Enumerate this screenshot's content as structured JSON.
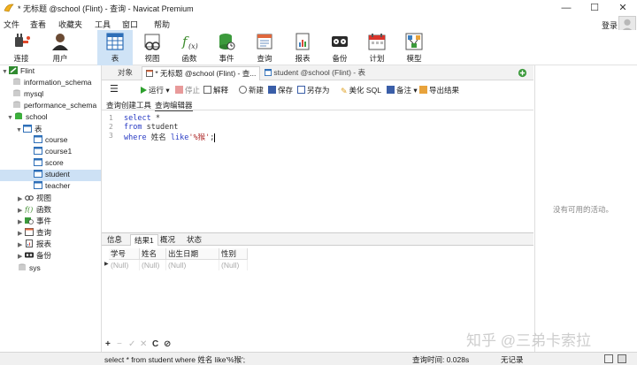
{
  "window": {
    "title": "* 无标题 @school (Flint) - 查询 - Navicat Premium",
    "minimize": "—",
    "maximize": "☐",
    "close": "✕"
  },
  "menu": [
    "文件",
    "查看",
    "收藏夹",
    "工具",
    "窗口",
    "帮助"
  ],
  "account": {
    "login_label": "登录"
  },
  "toolbar": [
    {
      "label": "连接",
      "icon": "plug-icon"
    },
    {
      "label": "用户",
      "icon": "user-icon"
    },
    {
      "label": "表",
      "icon": "table-icon",
      "active": true
    },
    {
      "label": "视图",
      "icon": "view-icon"
    },
    {
      "label": "函数",
      "icon": "function-icon"
    },
    {
      "label": "事件",
      "icon": "event-icon"
    },
    {
      "label": "查询",
      "icon": "query-icon"
    },
    {
      "label": "报表",
      "icon": "report-icon"
    },
    {
      "label": "备份",
      "icon": "backup-icon"
    },
    {
      "label": "计划",
      "icon": "calendar-icon"
    },
    {
      "label": "模型",
      "icon": "model-icon"
    }
  ],
  "tree": {
    "connection": "Flint",
    "databases": [
      "information_schema",
      "mysql",
      "performance_schema",
      "school",
      "sys"
    ],
    "tables_label": "表",
    "tables": [
      "course",
      "course1",
      "score",
      "student",
      "teacher"
    ],
    "selected_table": "student",
    "groups": [
      "视图",
      "函数",
      "事件",
      "查询",
      "报表",
      "备份"
    ]
  },
  "tabs": {
    "objects": "对象",
    "query_tab": "* 无标题 @school (Flint) - 查...",
    "table_tab": "student @school (Flint) - 表"
  },
  "query_toolbar": {
    "run": "运行",
    "stop": "停止",
    "explain": "解释",
    "new": "新建",
    "save": "保存",
    "save_as": "另存为",
    "beautify": "美化 SQL",
    "note": "备注",
    "export": "导出结果"
  },
  "sub_tabs": [
    "查询创建工具",
    "查询编辑器"
  ],
  "editor": {
    "line_numbers": [
      "1",
      "2",
      "3"
    ],
    "lines": [
      {
        "kw": "select",
        "rest": " *"
      },
      {
        "kw": "from",
        "rest": " student"
      },
      {
        "kw": "where",
        "rest": " 姓名 ",
        "kw2": "like",
        "str": "'%猴'",
        "tail": ";"
      }
    ]
  },
  "result_tabs": [
    "信息",
    "结果1",
    "概况",
    "状态"
  ],
  "grid": {
    "columns": [
      "学号",
      "姓名",
      "出生日期",
      "性别"
    ],
    "row": [
      "(Null)",
      "(Null)",
      "(Null)",
      "(Null)"
    ]
  },
  "grid_controls": [
    "+",
    "−",
    "✓",
    "✕",
    "C",
    "⊘"
  ],
  "right_panel": {
    "empty_text": "没有可用的活动。"
  },
  "status": {
    "sql": "select *  from student where 姓名 like'%猴';",
    "time": "查询时间: 0.028s",
    "records": "无记录"
  },
  "watermark": "知乎 @三弟卡索拉",
  "colors": {
    "selection": "#cde1f5",
    "accent": "#2a3cc4"
  }
}
